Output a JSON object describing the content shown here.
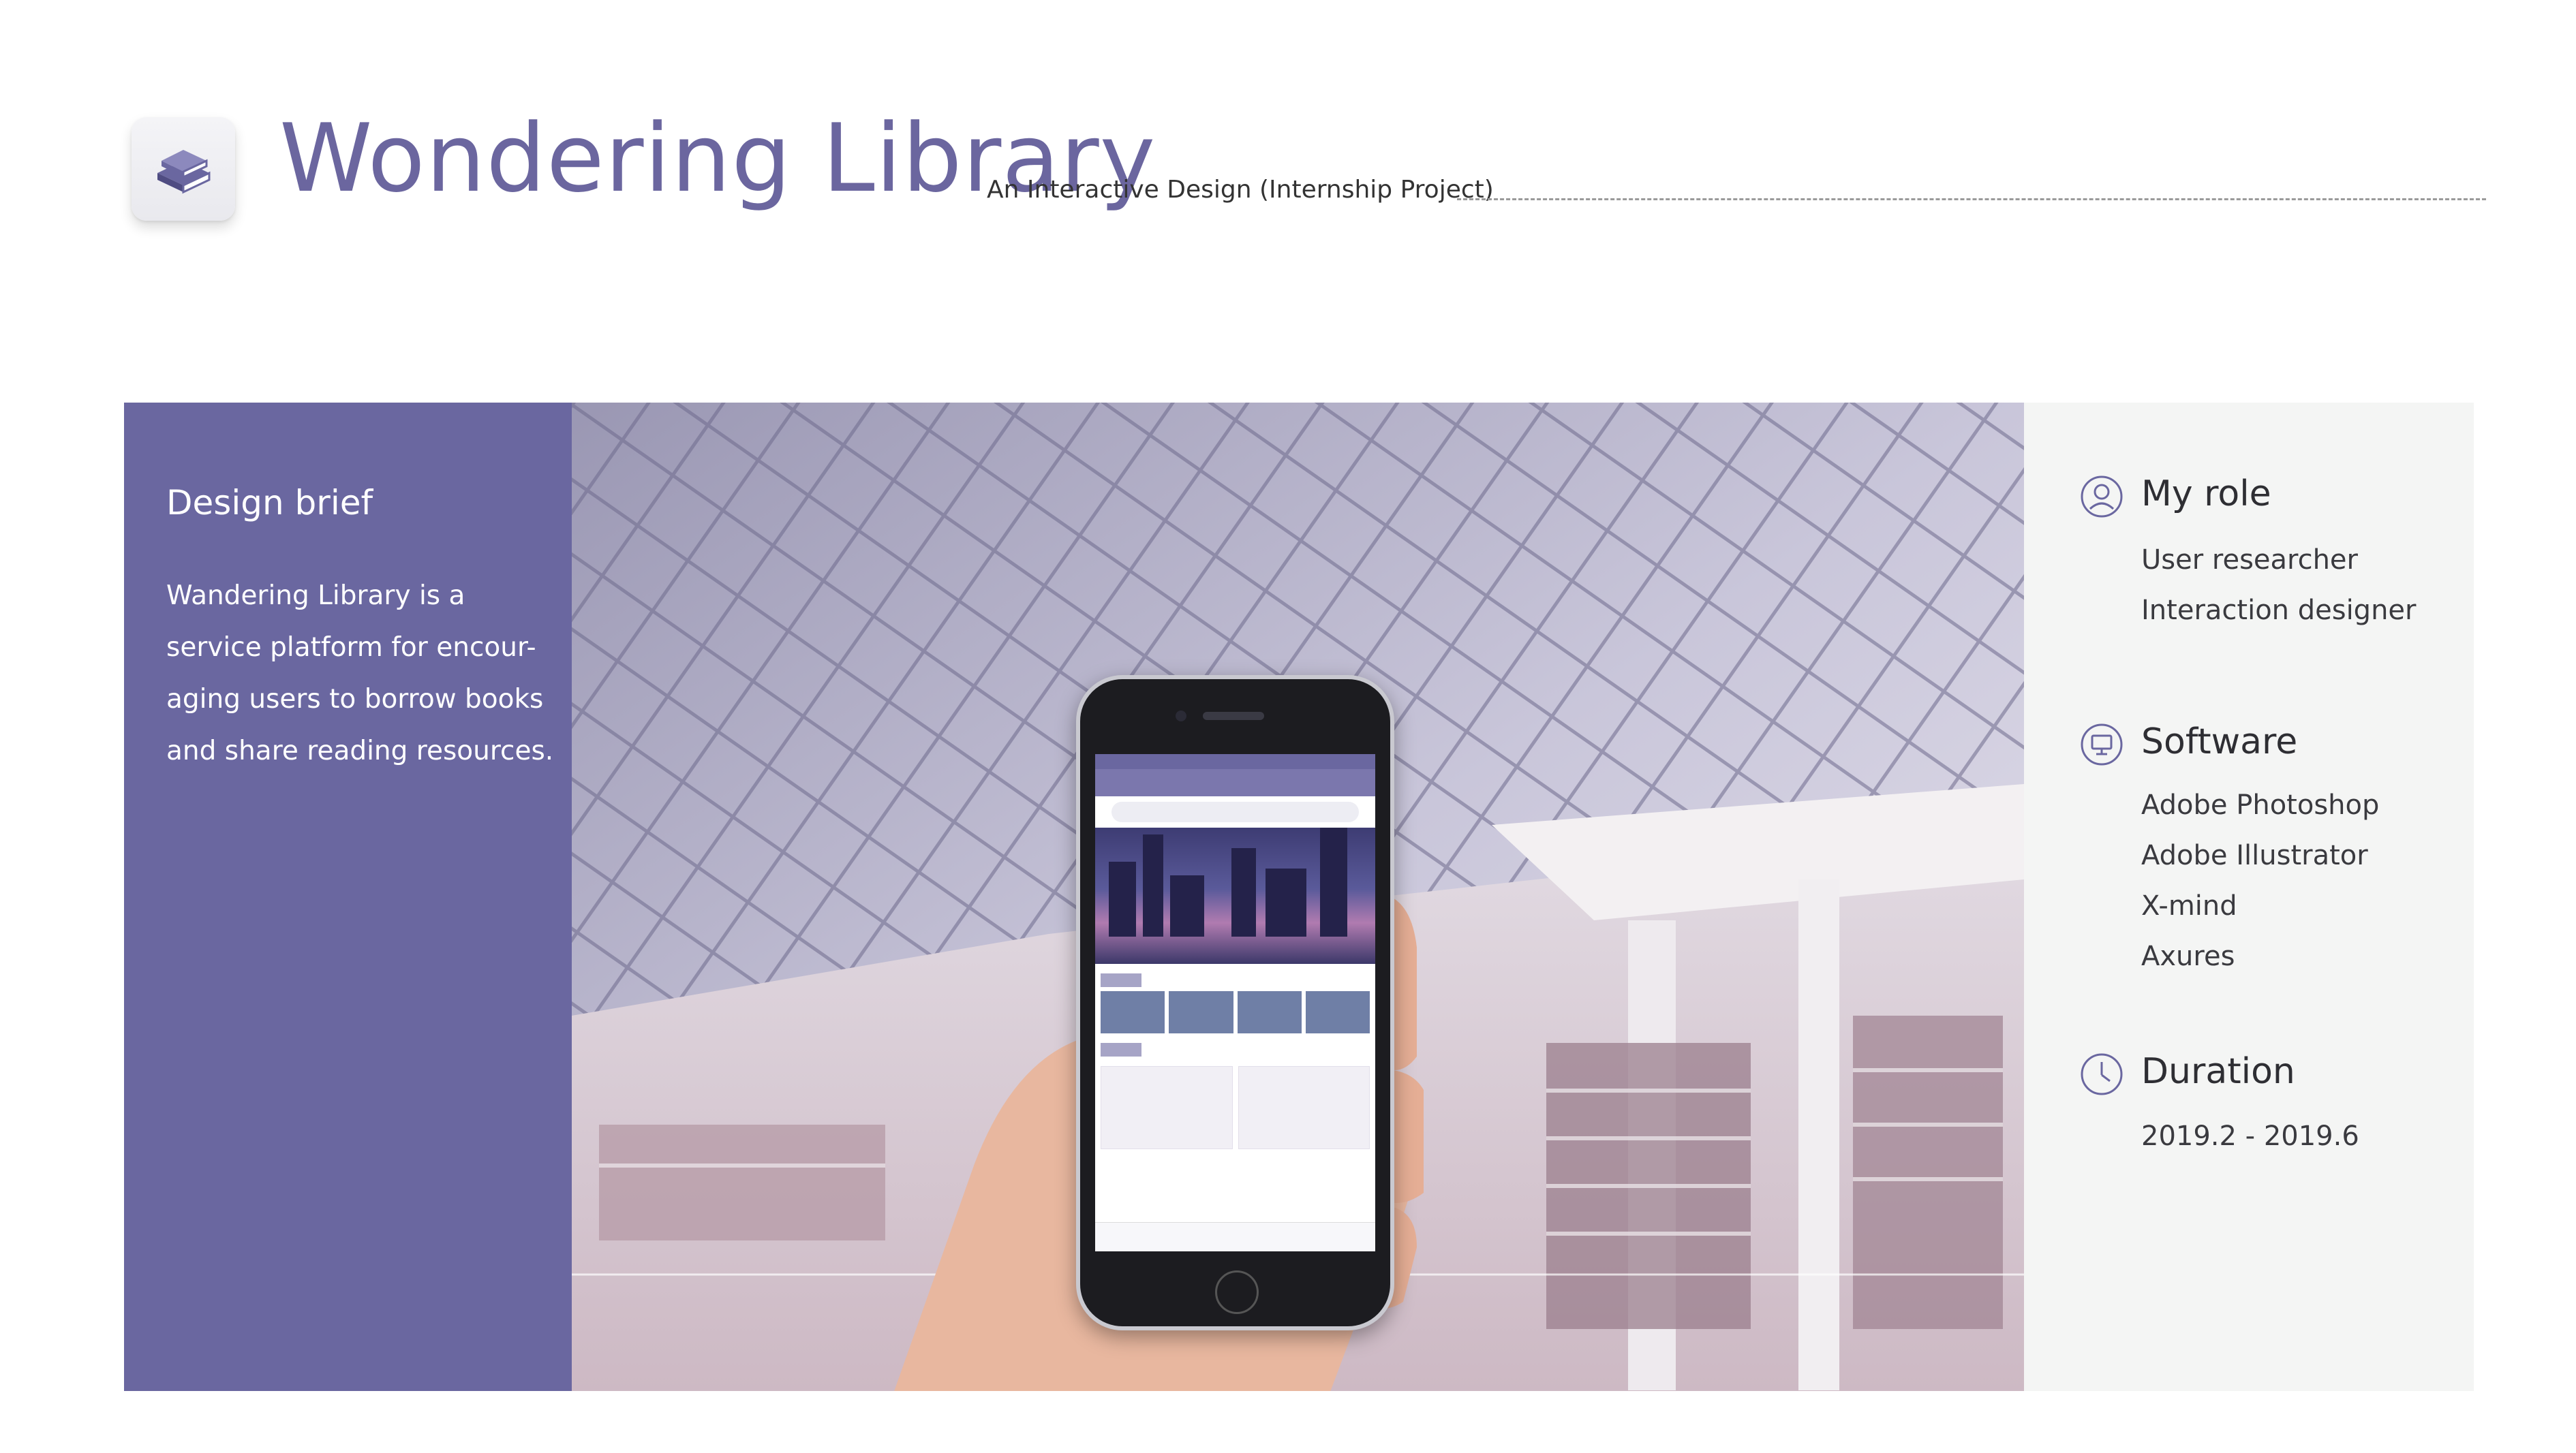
{
  "header": {
    "title": "Wondering Library",
    "subtitle": "An Interactive Design (Internship Project)",
    "logo_icon": "stacked-books-icon",
    "accent_color": "#6b669f"
  },
  "brief": {
    "heading": "Design brief",
    "lines": [
      "Wandering Library is a",
      "service platform for encour-",
      "aging users to borrow books",
      "and share reading resources."
    ],
    "background_color": "#6a67a0"
  },
  "hero_image": {
    "description_icon": "phone-mockup-in-library-photo"
  },
  "info": {
    "sections": [
      {
        "icon": "user-avatar-icon",
        "heading": "My role",
        "items": [
          "User researcher",
          "Interaction designer"
        ]
      },
      {
        "icon": "monitor-icon",
        "heading": "Software",
        "items": [
          "Adobe Photoshop",
          "Adobe Illustrator",
          "X-mind",
          "Axures"
        ]
      },
      {
        "icon": "clock-icon",
        "heading": "Duration",
        "items": [
          "2019.2 - 2019.6"
        ]
      }
    ],
    "background_color": "#f4f5f4"
  }
}
